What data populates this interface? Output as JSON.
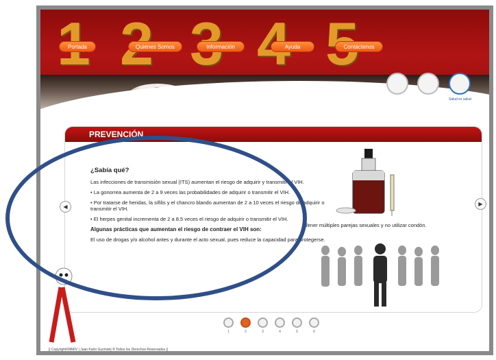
{
  "nav": {
    "items": [
      {
        "number": "1",
        "label": "Portada"
      },
      {
        "number": "2",
        "label": "Quiénes Somos"
      },
      {
        "number": "3",
        "label": "Información"
      },
      {
        "number": "4",
        "label": "Ayuda"
      },
      {
        "number": "5",
        "label": "Contáctenos"
      }
    ]
  },
  "logos": {
    "caption": "Salud es salud"
  },
  "panel": {
    "title": "PREVENCIÓN",
    "question": "¿Sabía qué?",
    "intro": "Las infecciones de transmisión sexual (ITS) aumentan el riesgo de adquirir y transmitir el VIH.",
    "bullets": [
      "• La gonorrea aumenta de 2 a 9 veces las probabilidades de adquirir o transmitir el VIH.",
      "• Por tratarse de heridas, la sífilis y el chancro blando aumentan de 2 a 10 veces el riesgo de adquirir o transmitir el VIH.",
      "• El herpes genital incrementa de 2 a 8.5 veces el riesgo de adquirir o transmitir el VIH."
    ],
    "subtitle": "Algunas prácticas que aumentan el riesgo de contraer el VIH son:",
    "practice": "El uso de drogas y/o alcohol antes y durante el acto sexual, pues reduce la capacidad para protegerse.",
    "image_caption": "Tener múltiples parejas sexuales y no utilizar condón."
  },
  "carousel": {
    "pages": [
      "1",
      "2",
      "3",
      "4",
      "5",
      "6"
    ],
    "active": 2,
    "prev_glyph": "◀",
    "next_glyph": "▶"
  },
  "footer": {
    "text": "|| Copyright©MMIV | Juan Karlo Guzmán| ® Todos los Derechos Reservados ||"
  },
  "colors": {
    "header_red": "#b11414",
    "button_orange": "#f05a14",
    "numeral_gold": "#e39a29",
    "annotation_blue": "#2f4f88"
  }
}
